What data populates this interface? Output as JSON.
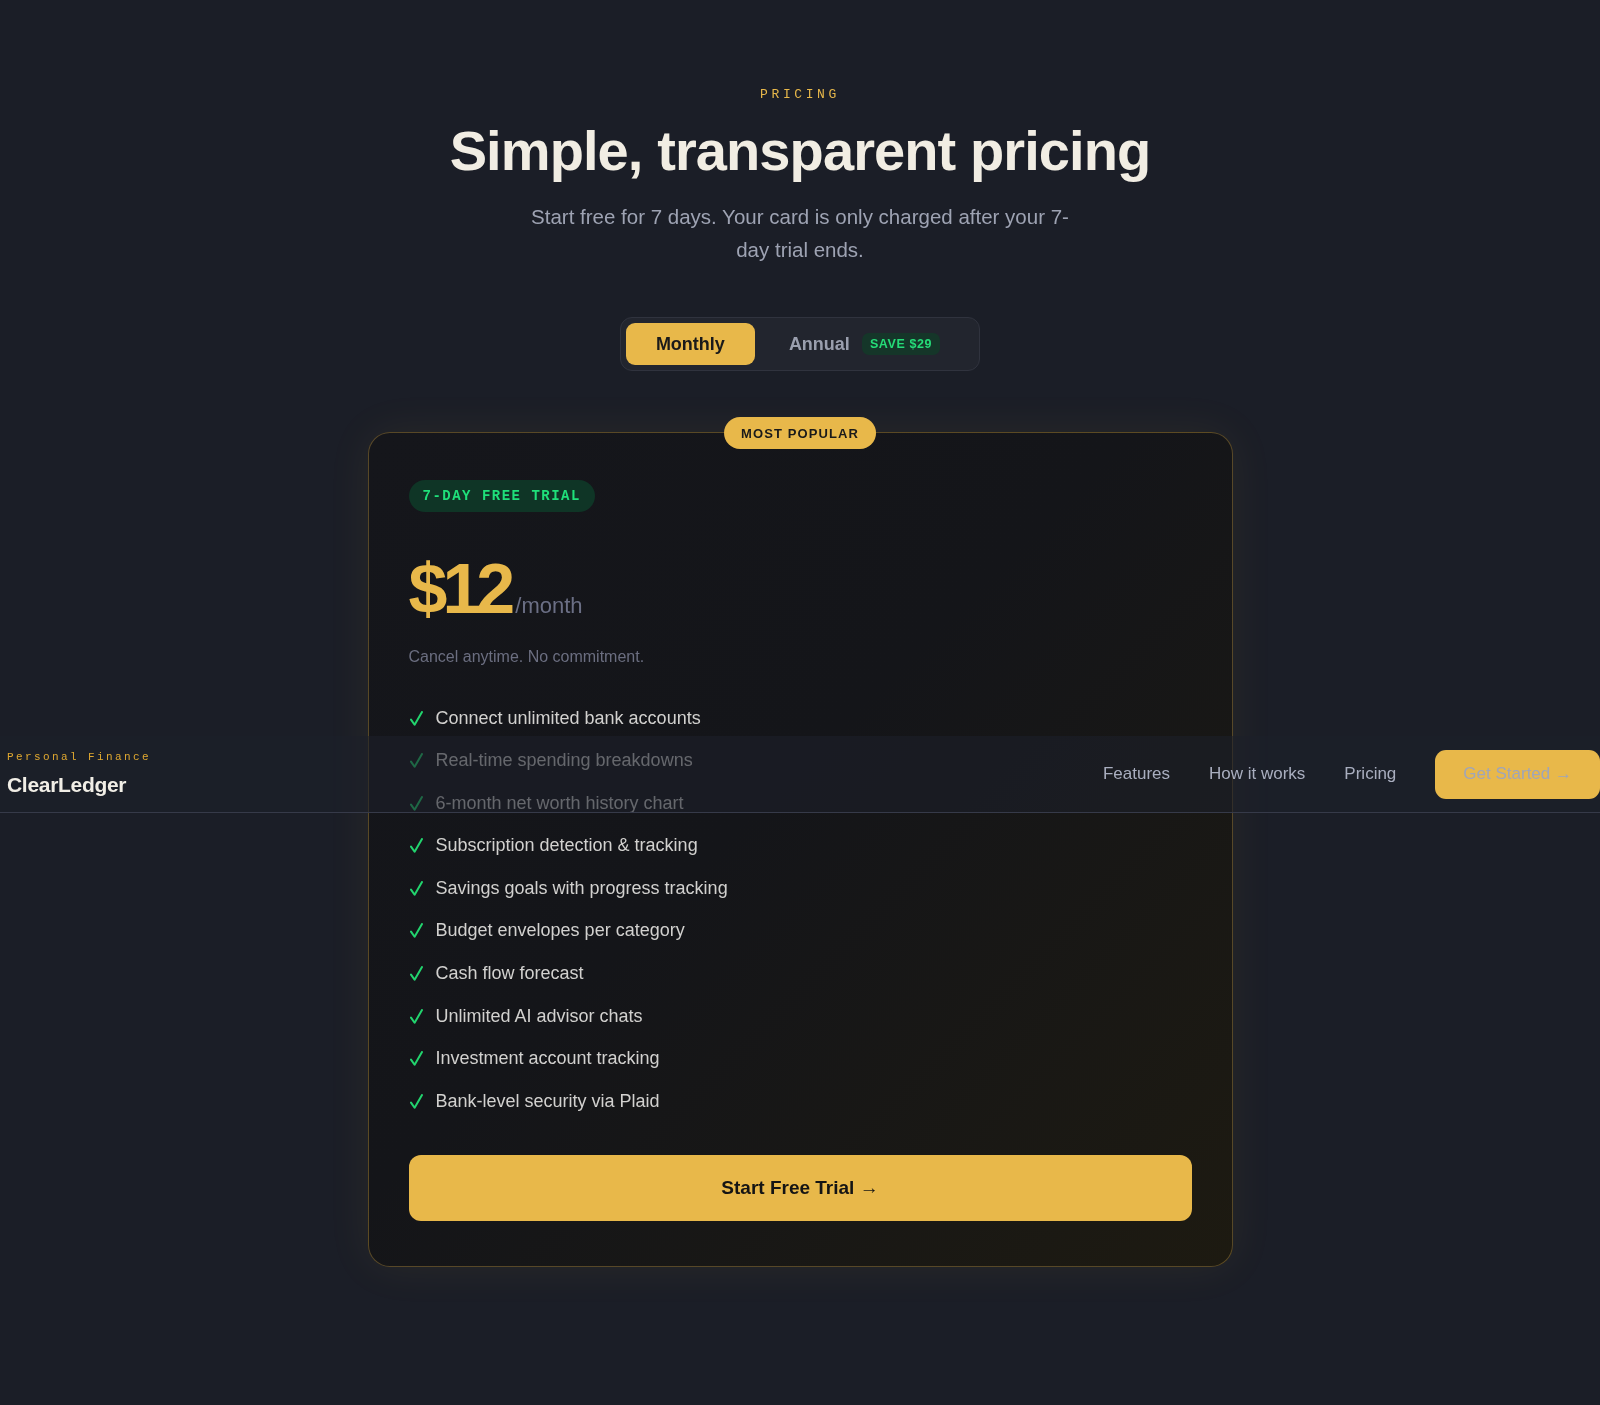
{
  "nav": {
    "tagline": "Personal Finance",
    "brand": "ClearLedger",
    "links": [
      {
        "label": "Features"
      },
      {
        "label": "How it works"
      },
      {
        "label": "Pricing"
      }
    ],
    "cta": "Get Started →"
  },
  "header": {
    "eyebrow": "PRICING",
    "title": "Simple, transparent pricing",
    "subtitle": "Start free for 7 days. Your card is only charged after your 7-day trial ends."
  },
  "billing_toggle": [
    {
      "label": "Monthly",
      "selected": true
    },
    {
      "label": "Annual",
      "selected": false,
      "badge": "SAVE $29"
    }
  ],
  "plan": {
    "badge": "MOST POPULAR",
    "trial_tag": "7-DAY FREE TRIAL",
    "price": "$12",
    "period": "/month",
    "note": "Cancel anytime. No commitment.",
    "features": [
      "Connect unlimited bank accounts",
      "Real-time spending breakdowns",
      "6-month net worth history chart",
      "Subscription detection & tracking",
      "Savings goals with progress tracking",
      "Budget envelopes per category",
      "Cash flow forecast",
      "Unlimited AI advisor chats",
      "Investment account tracking",
      "Bank-level security via Plaid"
    ],
    "cta": "Start Free Trial →"
  }
}
